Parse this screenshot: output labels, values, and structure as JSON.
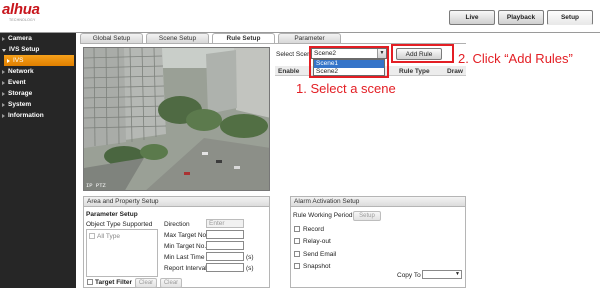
{
  "brand": {
    "name": "alhua",
    "sub": "TECHNOLOGY"
  },
  "top_tabs": [
    {
      "label": "Live"
    },
    {
      "label": "Playback"
    },
    {
      "label": "Setup",
      "active": true
    }
  ],
  "sidebar": {
    "items": [
      {
        "label": "Camera"
      },
      {
        "label": "IVS Setup",
        "expanded": true
      },
      {
        "label": "IVS",
        "selected": true
      },
      {
        "label": "Network"
      },
      {
        "label": "Event"
      },
      {
        "label": "Storage"
      },
      {
        "label": "System"
      },
      {
        "label": "Information"
      }
    ]
  },
  "main_tabs": [
    {
      "label": "Global Setup"
    },
    {
      "label": "Scene Setup"
    },
    {
      "label": "Rule Setup",
      "active": true
    },
    {
      "label": "Parameter"
    }
  ],
  "video": {
    "osd": "IP PTZ"
  },
  "rule": {
    "select_label": "Select Scene",
    "select_value": "Scene2",
    "options": [
      {
        "label": "Scene1",
        "highlighted": true
      },
      {
        "label": "Scene2"
      }
    ],
    "add_button": "Add Rule",
    "table_headers": {
      "enable": "Enable",
      "rule_type": "Rule Type",
      "draw": "Draw"
    }
  },
  "annotations": {
    "step1": "1. Select a scene",
    "step2": "2. Click “Add Rules”"
  },
  "area_panel": {
    "title": "Area and Property Setup",
    "param_title": "Parameter Setup",
    "object_type_label": "Object Type Supported",
    "all_type_label": "All Type",
    "direction_label": "Direction",
    "direction_value": "Enter",
    "max_target": "Max Target No.",
    "min_target": "Min Target No.",
    "min_last_time": "Min Last Time",
    "min_last_time_unit": "(s)",
    "report_interval": "Report Interval",
    "report_interval_unit": "(s)",
    "target_filter": "Target Filter",
    "clear1": "Clear",
    "clear2": "Clear"
  },
  "alarm_panel": {
    "title": "Alarm Activation Setup",
    "working_period": "Rule Working Period",
    "setup_button": "Setup",
    "record": "Record",
    "relay_out": "Relay-out",
    "send_email": "Send Email",
    "snapshot": "Snapshot",
    "copy_to": "Copy To"
  },
  "colors": {
    "accent_orange": "#f39c12",
    "annotation_red": "#e31e24",
    "brand_red": "#c8161d",
    "sidebar_bg": "#262626"
  }
}
